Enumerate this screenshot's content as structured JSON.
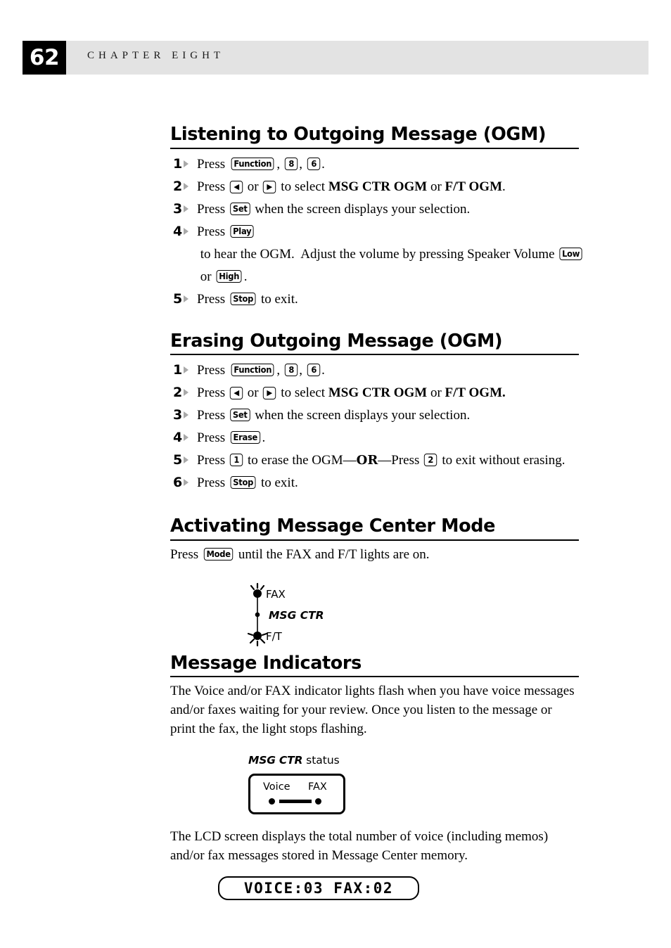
{
  "header": {
    "page_number": "62",
    "chapter_label": "CHAPTER EIGHT"
  },
  "sections": [
    {
      "id": "listening",
      "heading": "Listening to Outgoing Message (OGM)",
      "steps": [
        {
          "num": "1",
          "parts": [
            {
              "t": "text",
              "v": "Press "
            },
            {
              "t": "key",
              "v": "Function"
            },
            {
              "t": "text",
              "v": ", "
            },
            {
              "t": "key",
              "v": "8"
            },
            {
              "t": "text",
              "v": ", "
            },
            {
              "t": "key",
              "v": "6"
            },
            {
              "t": "text",
              "v": "."
            }
          ]
        },
        {
          "num": "2",
          "parts": [
            {
              "t": "text",
              "v": "Press "
            },
            {
              "t": "key",
              "v": "◀"
            },
            {
              "t": "text",
              "v": " or "
            },
            {
              "t": "key",
              "v": "▶"
            },
            {
              "t": "text",
              "v": " to select "
            },
            {
              "t": "bold",
              "v": "MSG CTR OGM"
            },
            {
              "t": "text",
              "v": " or "
            },
            {
              "t": "bold",
              "v": "F/T OGM"
            },
            {
              "t": "text",
              "v": "."
            }
          ]
        },
        {
          "num": "3",
          "parts": [
            {
              "t": "text",
              "v": "Press "
            },
            {
              "t": "key",
              "v": "Set"
            },
            {
              "t": "text",
              "v": " when the screen displays your selection."
            }
          ]
        },
        {
          "num": "4",
          "parts": [
            {
              "t": "text",
              "v": "Press "
            },
            {
              "t": "key",
              "v": "Play"
            },
            {
              "t": "text",
              "v": " to hear the OGM.  Adjust the volume by pressing Speaker Volume "
            },
            {
              "t": "key",
              "v": "Low"
            },
            {
              "t": "text",
              "v": " or "
            },
            {
              "t": "key",
              "v": "High"
            },
            {
              "t": "text",
              "v": "."
            }
          ]
        },
        {
          "num": "5",
          "parts": [
            {
              "t": "text",
              "v": "Press "
            },
            {
              "t": "key",
              "v": "Stop"
            },
            {
              "t": "text",
              "v": " to exit."
            }
          ]
        }
      ]
    },
    {
      "id": "erasing",
      "heading": "Erasing Outgoing Message (OGM)",
      "steps": [
        {
          "num": "1",
          "parts": [
            {
              "t": "text",
              "v": "Press "
            },
            {
              "t": "key",
              "v": "Function"
            },
            {
              "t": "text",
              "v": ", "
            },
            {
              "t": "key",
              "v": "8"
            },
            {
              "t": "text",
              "v": ", "
            },
            {
              "t": "key",
              "v": "6"
            },
            {
              "t": "text",
              "v": "."
            }
          ]
        },
        {
          "num": "2",
          "parts": [
            {
              "t": "text",
              "v": "Press "
            },
            {
              "t": "key",
              "v": "◀"
            },
            {
              "t": "text",
              "v": " or "
            },
            {
              "t": "key",
              "v": "▶"
            },
            {
              "t": "text",
              "v": " to select "
            },
            {
              "t": "bold",
              "v": "MSG CTR OGM"
            },
            {
              "t": "text",
              "v": " or "
            },
            {
              "t": "bold",
              "v": "F/T OGM."
            }
          ]
        },
        {
          "num": "3",
          "parts": [
            {
              "t": "text",
              "v": "Press "
            },
            {
              "t": "key",
              "v": "Set"
            },
            {
              "t": "text",
              "v": " when the screen displays your selection."
            }
          ]
        },
        {
          "num": "4",
          "parts": [
            {
              "t": "text",
              "v": "Press "
            },
            {
              "t": "key",
              "v": "Erase"
            },
            {
              "t": "text",
              "v": "."
            }
          ]
        },
        {
          "num": "5",
          "parts": [
            {
              "t": "text",
              "v": "Press "
            },
            {
              "t": "key",
              "v": "1"
            },
            {
              "t": "text",
              "v": " to erase the OGM—"
            },
            {
              "t": "orbold",
              "v": "OR"
            },
            {
              "t": "text",
              "v": "—Press "
            },
            {
              "t": "key",
              "v": "2"
            },
            {
              "t": "text",
              "v": " to exit without erasing."
            }
          ]
        },
        {
          "num": "6",
          "parts": [
            {
              "t": "text",
              "v": "Press "
            },
            {
              "t": "key",
              "v": "Stop"
            },
            {
              "t": "text",
              "v": " to exit."
            }
          ]
        }
      ]
    }
  ],
  "activating": {
    "heading": "Activating Message Center Mode",
    "instruction": [
      {
        "t": "text",
        "v": "Press "
      },
      {
        "t": "key",
        "v": "Mode"
      },
      {
        "t": "text",
        "v": " until the FAX and F/T lights are on."
      }
    ],
    "led_figure": {
      "leds": [
        {
          "label": "FAX",
          "state": "on",
          "style": "plain"
        },
        {
          "label": "MSG CTR",
          "state": "off",
          "style": "bold-italic"
        },
        {
          "label": "F/T",
          "state": "on",
          "style": "plain"
        }
      ]
    }
  },
  "message_indicators": {
    "heading": "Message Indicators",
    "paragraph1": "The Voice and/or FAX indicator lights flash when you have voice messages and/or faxes waiting for your review.  Once you listen to the message or print the fax, the light stops flashing.",
    "status_panel": {
      "caption_bold": "MSG CTR",
      "caption_rest": " status",
      "label_left": "Voice",
      "label_right": "FAX"
    },
    "paragraph2": "The LCD screen displays the total number of voice (including memos) and/or fax messages stored in Message Center memory.",
    "lcd": {
      "text": "VOICE:03 FAX:02",
      "voice_count": "03",
      "fax_count": "02"
    }
  },
  "colors": {
    "band": "#e3e3e3",
    "page_box": "#000000",
    "arrow_gray": "#a9a9a9"
  }
}
